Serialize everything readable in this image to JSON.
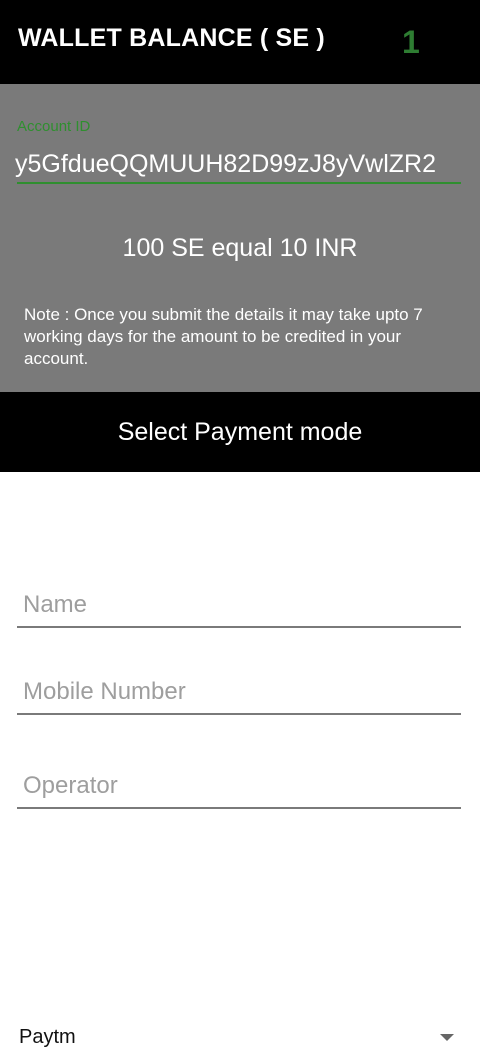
{
  "header": {
    "title": "WALLET BALANCE ( SE )",
    "balance": "1",
    "balance_color": "#2e7d32"
  },
  "account": {
    "label": "Account ID",
    "value": "y5GfdueQQMUUH82D99zJ8yVwlZR2",
    "accent_color": "#2f8f2f"
  },
  "info": {
    "rate": "100 SE equal 10 INR",
    "note": "Note : Once you submit the details it may take upto 7 working days for the amount to be credited in your account."
  },
  "payment": {
    "title": "Select Payment mode",
    "mode": "Paytm",
    "mode_icon": "dropdown-triangle-icon"
  },
  "form": {
    "name_placeholder": "Name",
    "mobile_placeholder": "Mobile Number",
    "operator_placeholder": "Operator"
  }
}
